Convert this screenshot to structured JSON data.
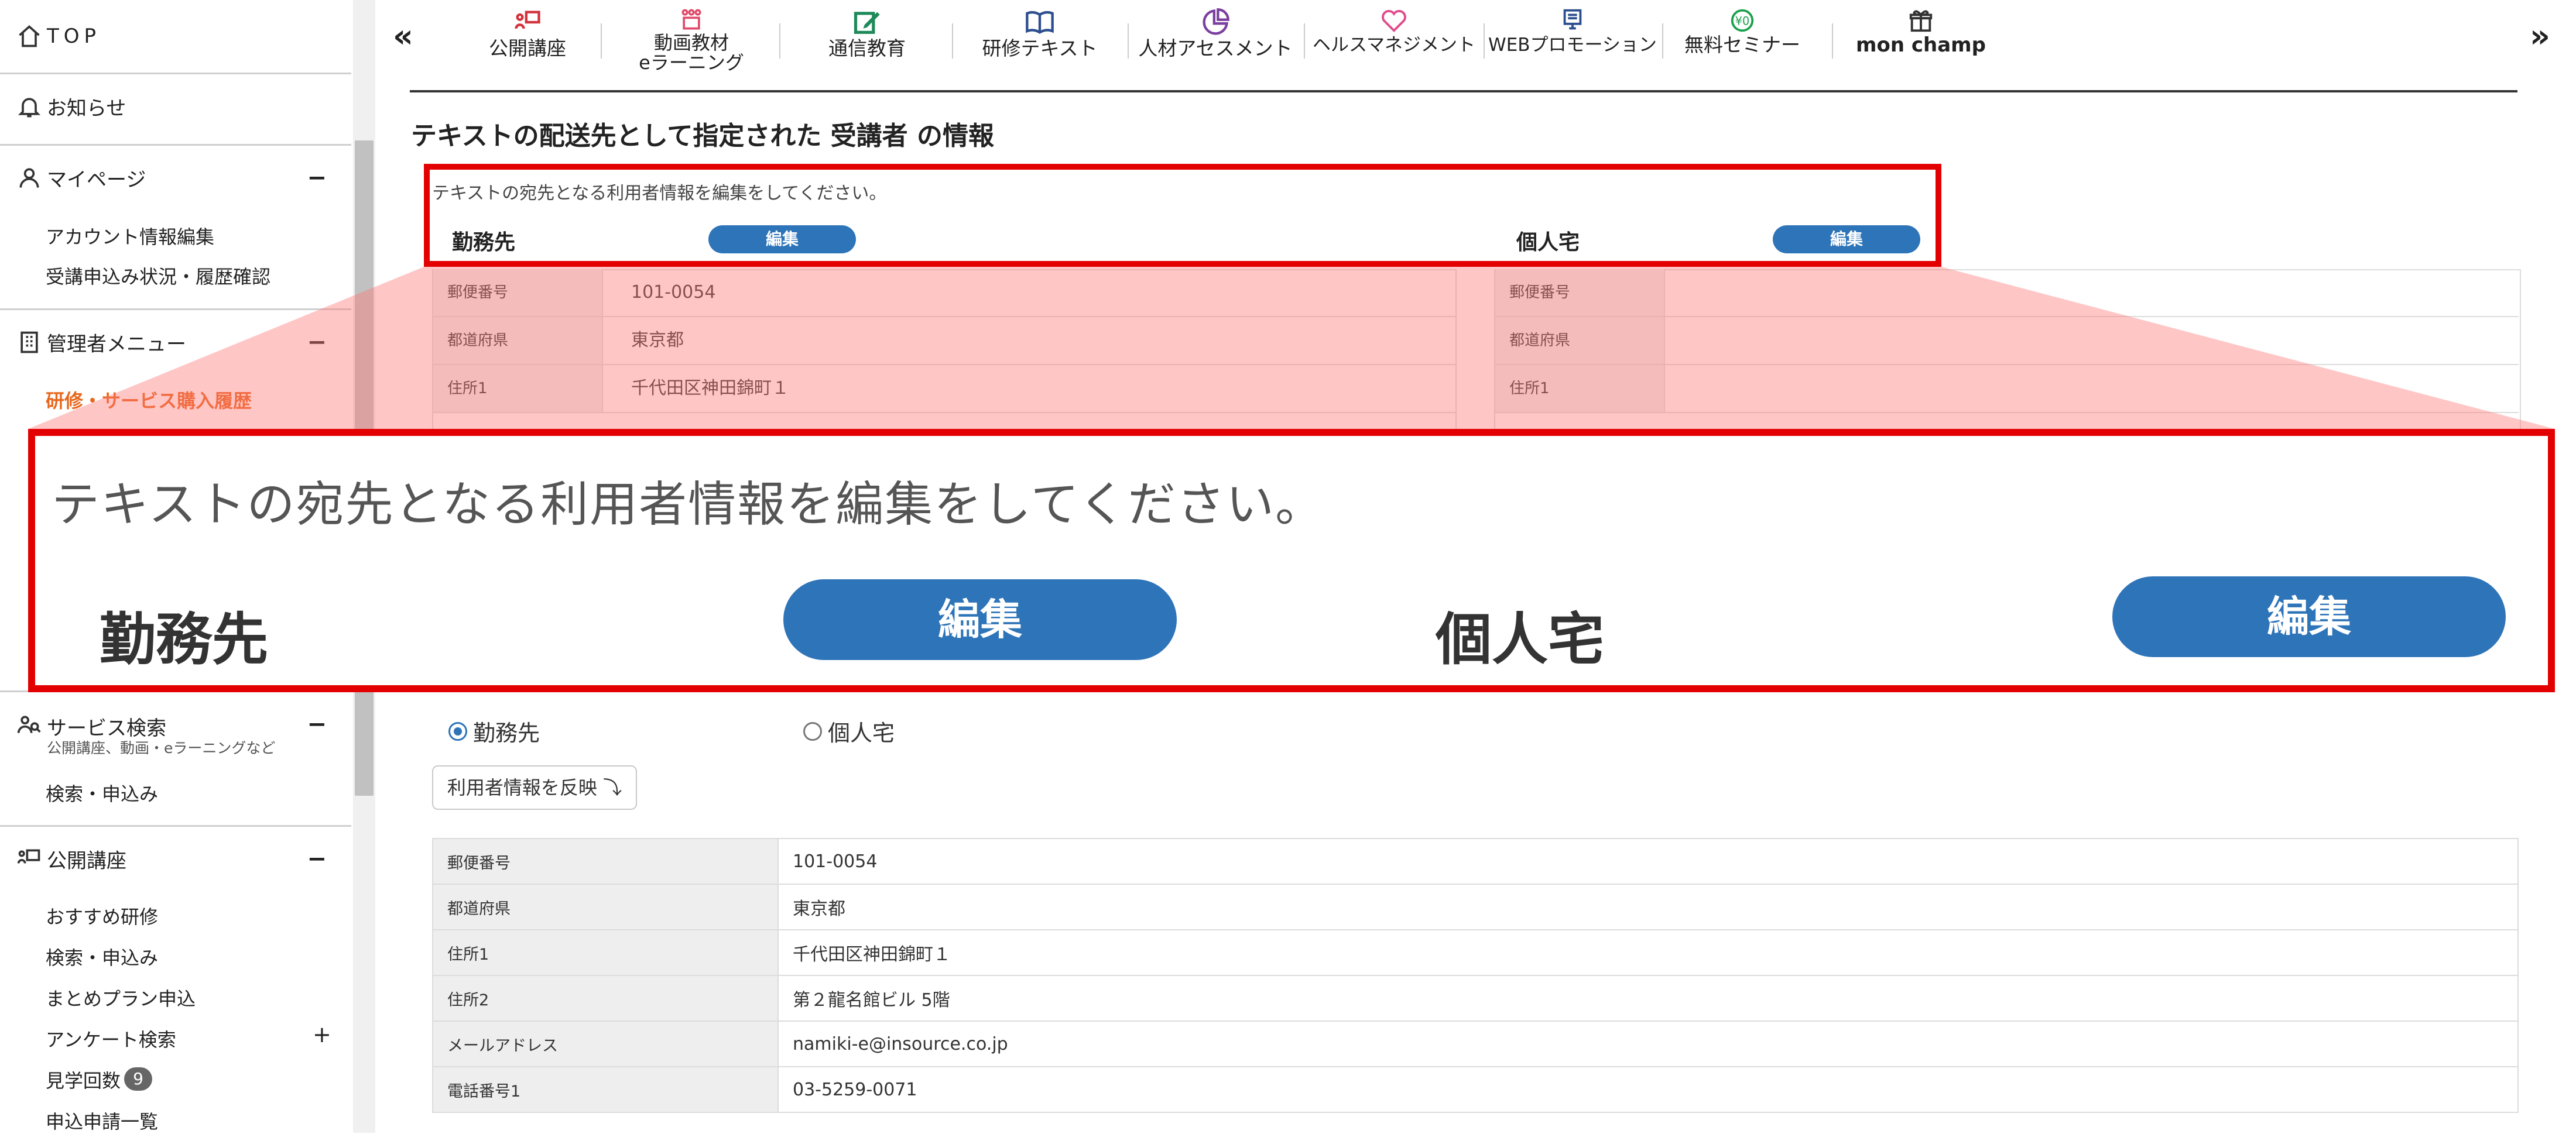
{
  "sidebar": {
    "top_label": "TOP",
    "news_label": "お知らせ",
    "mypage": {
      "label": "マイページ",
      "toggle": "−",
      "items": [
        "アカウント情報編集",
        "受講申込み状況・履歴確認"
      ]
    },
    "admin": {
      "label": "管理者メニュー",
      "toggle": "−",
      "items": [
        "研修・サービス購入履歴"
      ]
    },
    "service_search": {
      "label": "サービス検索",
      "sub": "公開講座、動画・eラーニングなど",
      "toggle": "−",
      "items": [
        "検索・申込み"
      ]
    },
    "public_course": {
      "label": "公開講座",
      "toggle": "−",
      "items": [
        "おすすめ研修",
        "検索・申込み",
        "まとめプラン申込",
        "アンケート検索",
        "見学回数",
        "申込申請一覧"
      ],
      "survey_toggle": "+",
      "visit_count": "9"
    }
  },
  "topnav": {
    "prev": "«",
    "next": "»",
    "items": [
      {
        "label": "公開講座",
        "icon": "presentation-icon"
      },
      {
        "label": "動画教材\neラーニング",
        "icon": "video-people-icon"
      },
      {
        "label": "通信教育",
        "icon": "edit-icon"
      },
      {
        "label": "研修テキスト",
        "icon": "book-icon"
      },
      {
        "label": "人材アセスメント",
        "icon": "pie-chart-icon"
      },
      {
        "label": "ヘルスマネジメント",
        "icon": "heart-icon"
      },
      {
        "label": "WEBプロモーション",
        "icon": "monitor-icon"
      },
      {
        "label": "無料セミナー",
        "icon": "free-badge-icon"
      },
      {
        "label": "mon champ",
        "icon": "gift-icon"
      }
    ]
  },
  "main": {
    "section_title": "テキストの配送先として指定された 受講者 の情報",
    "instruction": "テキストの宛先となる利用者情報を編集をしてください。",
    "work_label": "勤務先",
    "home_label": "個人宅",
    "edit_label": "編集",
    "mini_table": {
      "keys": [
        "郵便番号",
        "都道府県",
        "住所1"
      ],
      "work_values": [
        "101-0054",
        "東京都",
        "千代田区神田錦町１"
      ]
    },
    "radio": {
      "work": "勤務先",
      "home": "個人宅",
      "selected": "work"
    },
    "reflect_button": "利用者情報を反映 ⤵",
    "info_table": [
      {
        "k": "郵便番号",
        "v": "101-0054"
      },
      {
        "k": "都道府県",
        "v": "東京都"
      },
      {
        "k": "住所1",
        "v": "千代田区神田錦町１"
      },
      {
        "k": "住所2",
        "v": "第２龍名館ビル 5階"
      },
      {
        "k": "メールアドレス",
        "v": "namiki-e@insource.co.jp"
      },
      {
        "k": "電話番号1",
        "v": "03-5259-0071"
      }
    ]
  },
  "colors": {
    "accent_blue": "#2e74b8",
    "highlight_red": "#e30000",
    "active_orange": "#e8671c",
    "nav_icon_red": "#d2323c",
    "nav_icon_green": "#1e8a5a",
    "nav_icon_navy": "#2d4f8f",
    "nav_icon_purple": "#7b3fa0",
    "nav_icon_pink": "#e04a8a"
  }
}
